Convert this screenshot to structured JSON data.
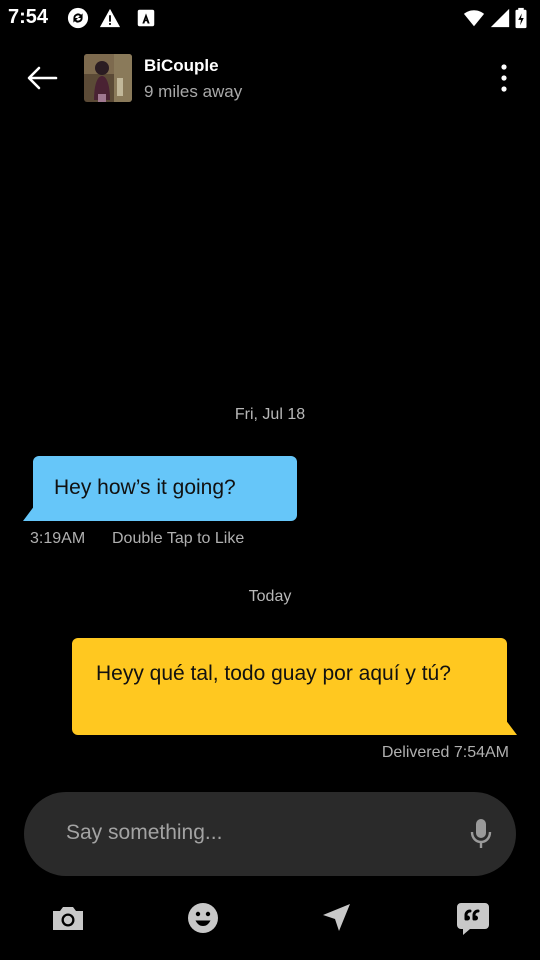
{
  "status_bar": {
    "time": "7:54",
    "icons": [
      "sync-icon",
      "warning-icon",
      "font-a-icon",
      "wifi-icon",
      "signal-icon",
      "battery-icon"
    ]
  },
  "header": {
    "contact_name": "BiCouple",
    "distance": "9 miles away"
  },
  "conversation": {
    "sections": [
      {
        "date": "Fri, Jul 18",
        "messages": [
          {
            "direction": "incoming",
            "text": "Hey how’s it going?",
            "time": "3:19AM",
            "hint": "Double Tap to Like",
            "bubble_color": "#66c6f9"
          }
        ]
      },
      {
        "date": "Today",
        "messages": [
          {
            "direction": "outgoing",
            "text": "Heyy qué tal, todo guay por aquí y tú?",
            "status": "Delivered 7:54AM",
            "bubble_color": "#ffc820"
          }
        ]
      }
    ]
  },
  "composer": {
    "placeholder": "Say something..."
  },
  "toolbar": {
    "icons": [
      "camera-icon",
      "emoji-icon",
      "location-icon",
      "saved-phrases-icon"
    ]
  },
  "colors": {
    "background": "#000000",
    "incoming_bubble": "#66c6f9",
    "outgoing_bubble": "#ffc820",
    "input_background": "#2a2a2a"
  }
}
